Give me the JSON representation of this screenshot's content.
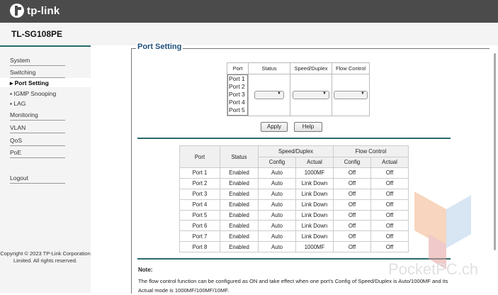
{
  "brand": "tp-link",
  "model": "TL-SG108PE",
  "sidebar": {
    "items": [
      {
        "label": "System"
      },
      {
        "label": "Switching"
      },
      {
        "label": "Port Setting"
      },
      {
        "label": "IGMP Snooping"
      },
      {
        "label": "LAG"
      },
      {
        "label": "Monitoring"
      },
      {
        "label": "VLAN"
      },
      {
        "label": "QoS"
      },
      {
        "label": "PoE"
      },
      {
        "label": "Logout"
      }
    ],
    "copyright": "Copyright © 2023 TP-Link Corporation Limited. All rights reserved."
  },
  "panel": {
    "title": "Port Setting",
    "setting_headers": {
      "port": "Port",
      "status": "Status",
      "speed": "Speed/Duplex",
      "flow": "Flow Control"
    },
    "port_options": [
      "Port 1",
      "Port 2",
      "Port 3",
      "Port 4",
      "Port 5"
    ],
    "apply_label": "Apply",
    "help_label": "Help"
  },
  "status_table": {
    "headers": {
      "port": "Port",
      "status": "Status",
      "speed": "Speed/Duplex",
      "flow": "Flow Control",
      "config": "Config",
      "actual": "Actual"
    },
    "rows": [
      [
        "Port 1",
        "Enabled",
        "Auto",
        "1000MF",
        "Off",
        "Off"
      ],
      [
        "Port 2",
        "Enabled",
        "Auto",
        "Link Down",
        "Off",
        "Off"
      ],
      [
        "Port 3",
        "Enabled",
        "Auto",
        "Link Down",
        "Off",
        "Off"
      ],
      [
        "Port 4",
        "Enabled",
        "Auto",
        "Link Down",
        "Off",
        "Off"
      ],
      [
        "Port 5",
        "Enabled",
        "Auto",
        "Link Down",
        "Off",
        "Off"
      ],
      [
        "Port 6",
        "Enabled",
        "Auto",
        "Link Down",
        "Off",
        "Off"
      ],
      [
        "Port 7",
        "Enabled",
        "Auto",
        "Link Down",
        "Off",
        "Off"
      ],
      [
        "Port 8",
        "Enabled",
        "Auto",
        "1000MF",
        "Off",
        "Off"
      ]
    ]
  },
  "note": {
    "title": "Note:",
    "text": "The flow control function can be configured as ON and take effect when one port's Config of Speed/Duplex is Auto/1000MF and its Actual mode is 1000MF/100MF/10MF."
  },
  "watermark": "PocketPC.ch",
  "colors": {
    "accent": "#1e4e79",
    "rule": "#2a6a6a",
    "topbar": "#4b4b4b"
  }
}
